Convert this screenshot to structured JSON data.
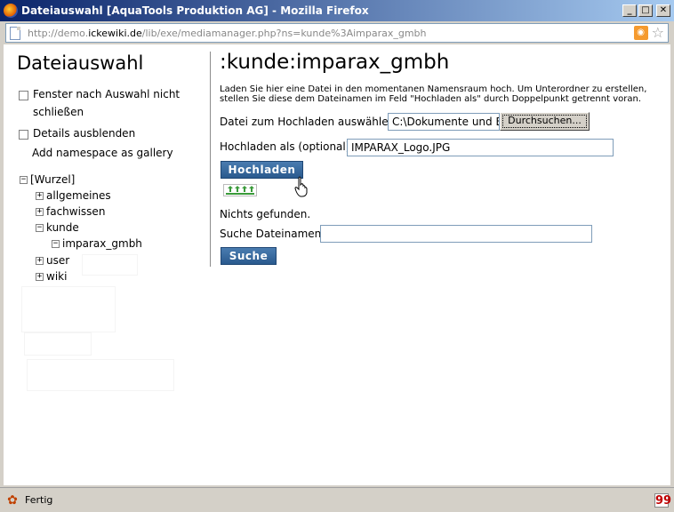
{
  "window": {
    "title": "Dateiauswahl [AquaTools Produktion AG] - Mozilla Firefox",
    "minimize": "_",
    "maximize": "□",
    "close": "✕"
  },
  "address": {
    "url_prefix": "http://demo.",
    "url_host": "ickewiki.de",
    "url_path": "/lib/exe/mediamanager.php?ns=kunde%3Aimparax_gmbh"
  },
  "sidebar": {
    "title": "Dateiauswahl",
    "options": [
      {
        "label_line1": "Fenster nach Auswahl nicht",
        "label_line2": "schließen",
        "checked": false
      },
      {
        "label": "Details ausblenden",
        "checked": false
      }
    ],
    "gallery_link": "Add namespace as gallery",
    "tree": {
      "root": "[Wurzel]",
      "items": [
        {
          "label": "allgemeines",
          "toggle": "+"
        },
        {
          "label": "fachwissen",
          "toggle": "+"
        },
        {
          "label": "kunde",
          "toggle": "−"
        },
        {
          "label": "imparax_gmbh",
          "toggle": "−"
        },
        {
          "label": "user",
          "toggle": "+"
        },
        {
          "label": "wiki",
          "toggle": "+"
        }
      ],
      "root_toggle": "−"
    }
  },
  "main": {
    "namespace_title": ":kunde:imparax_gmbh",
    "intro": "Laden Sie hier eine Datei in den momentanen Namensraum hoch. Um Unterordner zu erstellen, stellen Sie diese dem Dateinamen im Feld \"Hochladen als\" durch Doppelpunkt getrennt voran.",
    "upload_label": "Datei zum Hochladen auswählen:",
    "upload_value": "C:\\Dokumente und Ein",
    "browse_button": "Durchsuchen...",
    "upload_as_label": "Hochladen als (optional):",
    "upload_as_value": "IMPARAX_Logo.JPG",
    "upload_button": "Hochladen",
    "nothing_found": "Nichts gefunden.",
    "search_label": "Suche Dateinamen:",
    "search_value": "",
    "search_button": "Suche"
  },
  "status": {
    "text": "Fertig",
    "quote_icon": "99"
  },
  "icons": {
    "page": "page-icon",
    "rss": "rss-icon",
    "bookmark_star": "star-icon",
    "cursor": "hand-cursor-icon",
    "progress": "upload-progress-icon",
    "status": "firefox-status-icon",
    "quote": "quote-icon"
  }
}
